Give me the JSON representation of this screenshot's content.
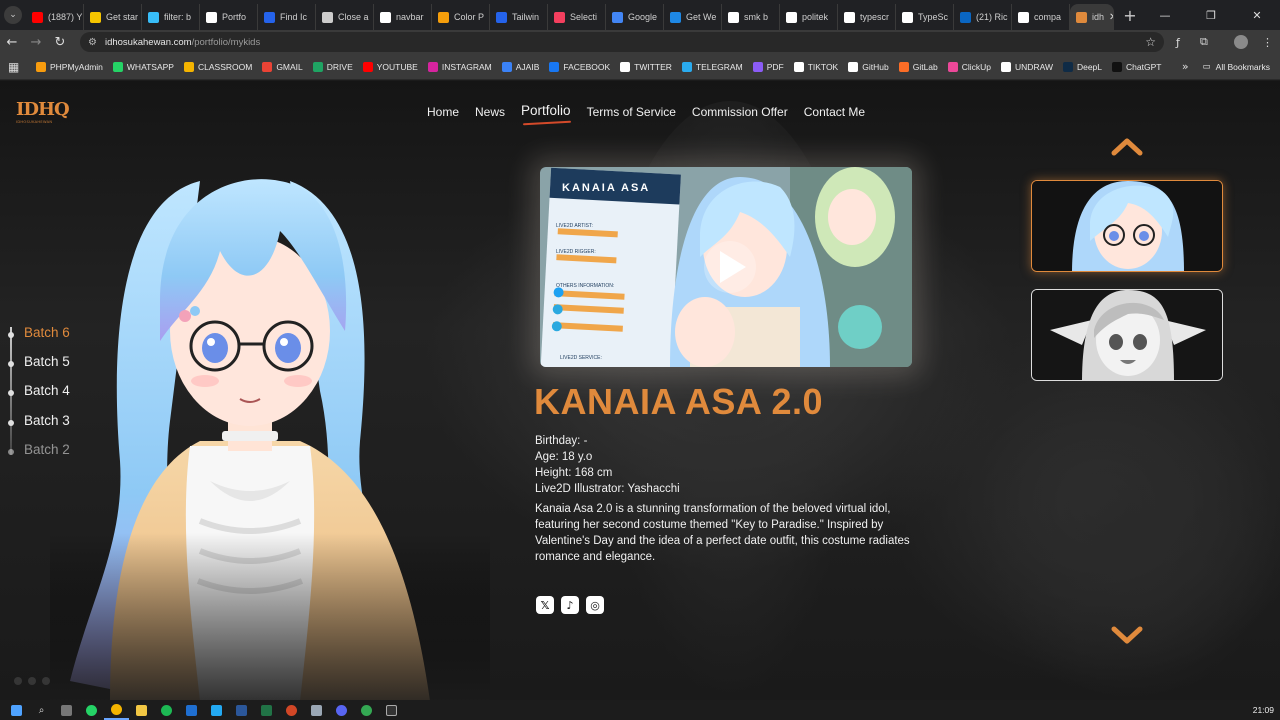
{
  "browser": {
    "tabs": [
      {
        "label": "(1887) Y",
        "color": "#ff0000"
      },
      {
        "label": "Get star",
        "color": "#f7c600"
      },
      {
        "label": "filter: b",
        "color": "#38bdf8"
      },
      {
        "label": "Portfo",
        "color": "#ffffff"
      },
      {
        "label": "Find Ic",
        "color": "#2563eb"
      },
      {
        "label": "Close a",
        "color": "#cccccc"
      },
      {
        "label": "navbar",
        "color": "#ffffff"
      },
      {
        "label": "Color P",
        "color": "#f59e0b"
      },
      {
        "label": "Tailwin",
        "color": "#2563eb"
      },
      {
        "label": "Selecti",
        "color": "#f43f5e"
      },
      {
        "label": "Google",
        "color": "#4285f4"
      },
      {
        "label": "Get We",
        "color": "#1e88e5"
      },
      {
        "label": "smk b",
        "color": "#ffffff"
      },
      {
        "label": "politek",
        "color": "#ffffff"
      },
      {
        "label": "typescr",
        "color": "#ffffff"
      },
      {
        "label": "TypeSc",
        "color": "#ffffff"
      },
      {
        "label": "(21) Ric",
        "color": "#0a66c2"
      },
      {
        "label": "compa",
        "color": "#ffffff"
      },
      {
        "label": "idh",
        "color": "#e08a3c"
      }
    ],
    "url_host": "idhosukahewan.com",
    "url_path": "/portfolio/mykids",
    "bookmarks": [
      {
        "label": "PHPMyAdmin",
        "color": "#f89c0e"
      },
      {
        "label": "WHATSAPP",
        "color": "#25d366"
      },
      {
        "label": "CLASSROOM",
        "color": "#f4b400"
      },
      {
        "label": "GMAIL",
        "color": "#ea4335"
      },
      {
        "label": "DRIVE",
        "color": "#1fa463"
      },
      {
        "label": "YOUTUBE",
        "color": "#ff0000"
      },
      {
        "label": "INSTAGRAM",
        "color": "#d6249f"
      },
      {
        "label": "AJAIB",
        "color": "#3b82f6"
      },
      {
        "label": "FACEBOOK",
        "color": "#1877f2"
      },
      {
        "label": "TWITTER",
        "color": "#ffffff"
      },
      {
        "label": "TELEGRAM",
        "color": "#2aabee"
      },
      {
        "label": "PDF",
        "color": "#8b5cf6"
      },
      {
        "label": "TIKTOK",
        "color": "#ffffff"
      },
      {
        "label": "GitHub",
        "color": "#ffffff"
      },
      {
        "label": "GitLab",
        "color": "#fc6d26"
      },
      {
        "label": "ClickUp",
        "color": "#ec4899"
      },
      {
        "label": "UNDRAW",
        "color": "#ffffff"
      },
      {
        "label": "DeepL",
        "color": "#0f2b46"
      },
      {
        "label": "ChatGPT",
        "color": "#111111"
      }
    ],
    "all_bookmarks": "All Bookmarks",
    "more_glyph": "»"
  },
  "nav": {
    "home": "Home",
    "news": "News",
    "portfolio": "Portfolio",
    "tos": "Terms of Service",
    "commission": "Commission Offer",
    "contact": "Contact Me"
  },
  "batches": [
    "Batch 6",
    "Batch 5",
    "Batch 4",
    "Batch 3",
    "Batch 2"
  ],
  "video": {
    "card_title": "KANAIA ASA",
    "rows": [
      "LIVE2D ARTIST:",
      "LIVE2D RIGGER:",
      "OTHERS INFORMATION:",
      "LIVE2D SERVICE:"
    ]
  },
  "character": {
    "name": "KANAIA ASA 2.0",
    "birthday": "Birthday: -",
    "age": "Age: 18 y.o",
    "height": "Height: 168 cm",
    "illustrator": "Live2D Illustrator: Yashacchi",
    "description": "Kanaia Asa 2.0 is a stunning transformation of the beloved virtual idol, featuring her second costume themed \"Key to Paradise.\" Inspired by Valentine's Day and the idea of a perfect date outfit, this costume radiates romance and elegance."
  },
  "logo": {
    "mark": "IDHQ",
    "sub": "IDHOSUKAHEWAN"
  },
  "accent": "#e08a3c",
  "taskbar": {
    "time": "21:09"
  }
}
